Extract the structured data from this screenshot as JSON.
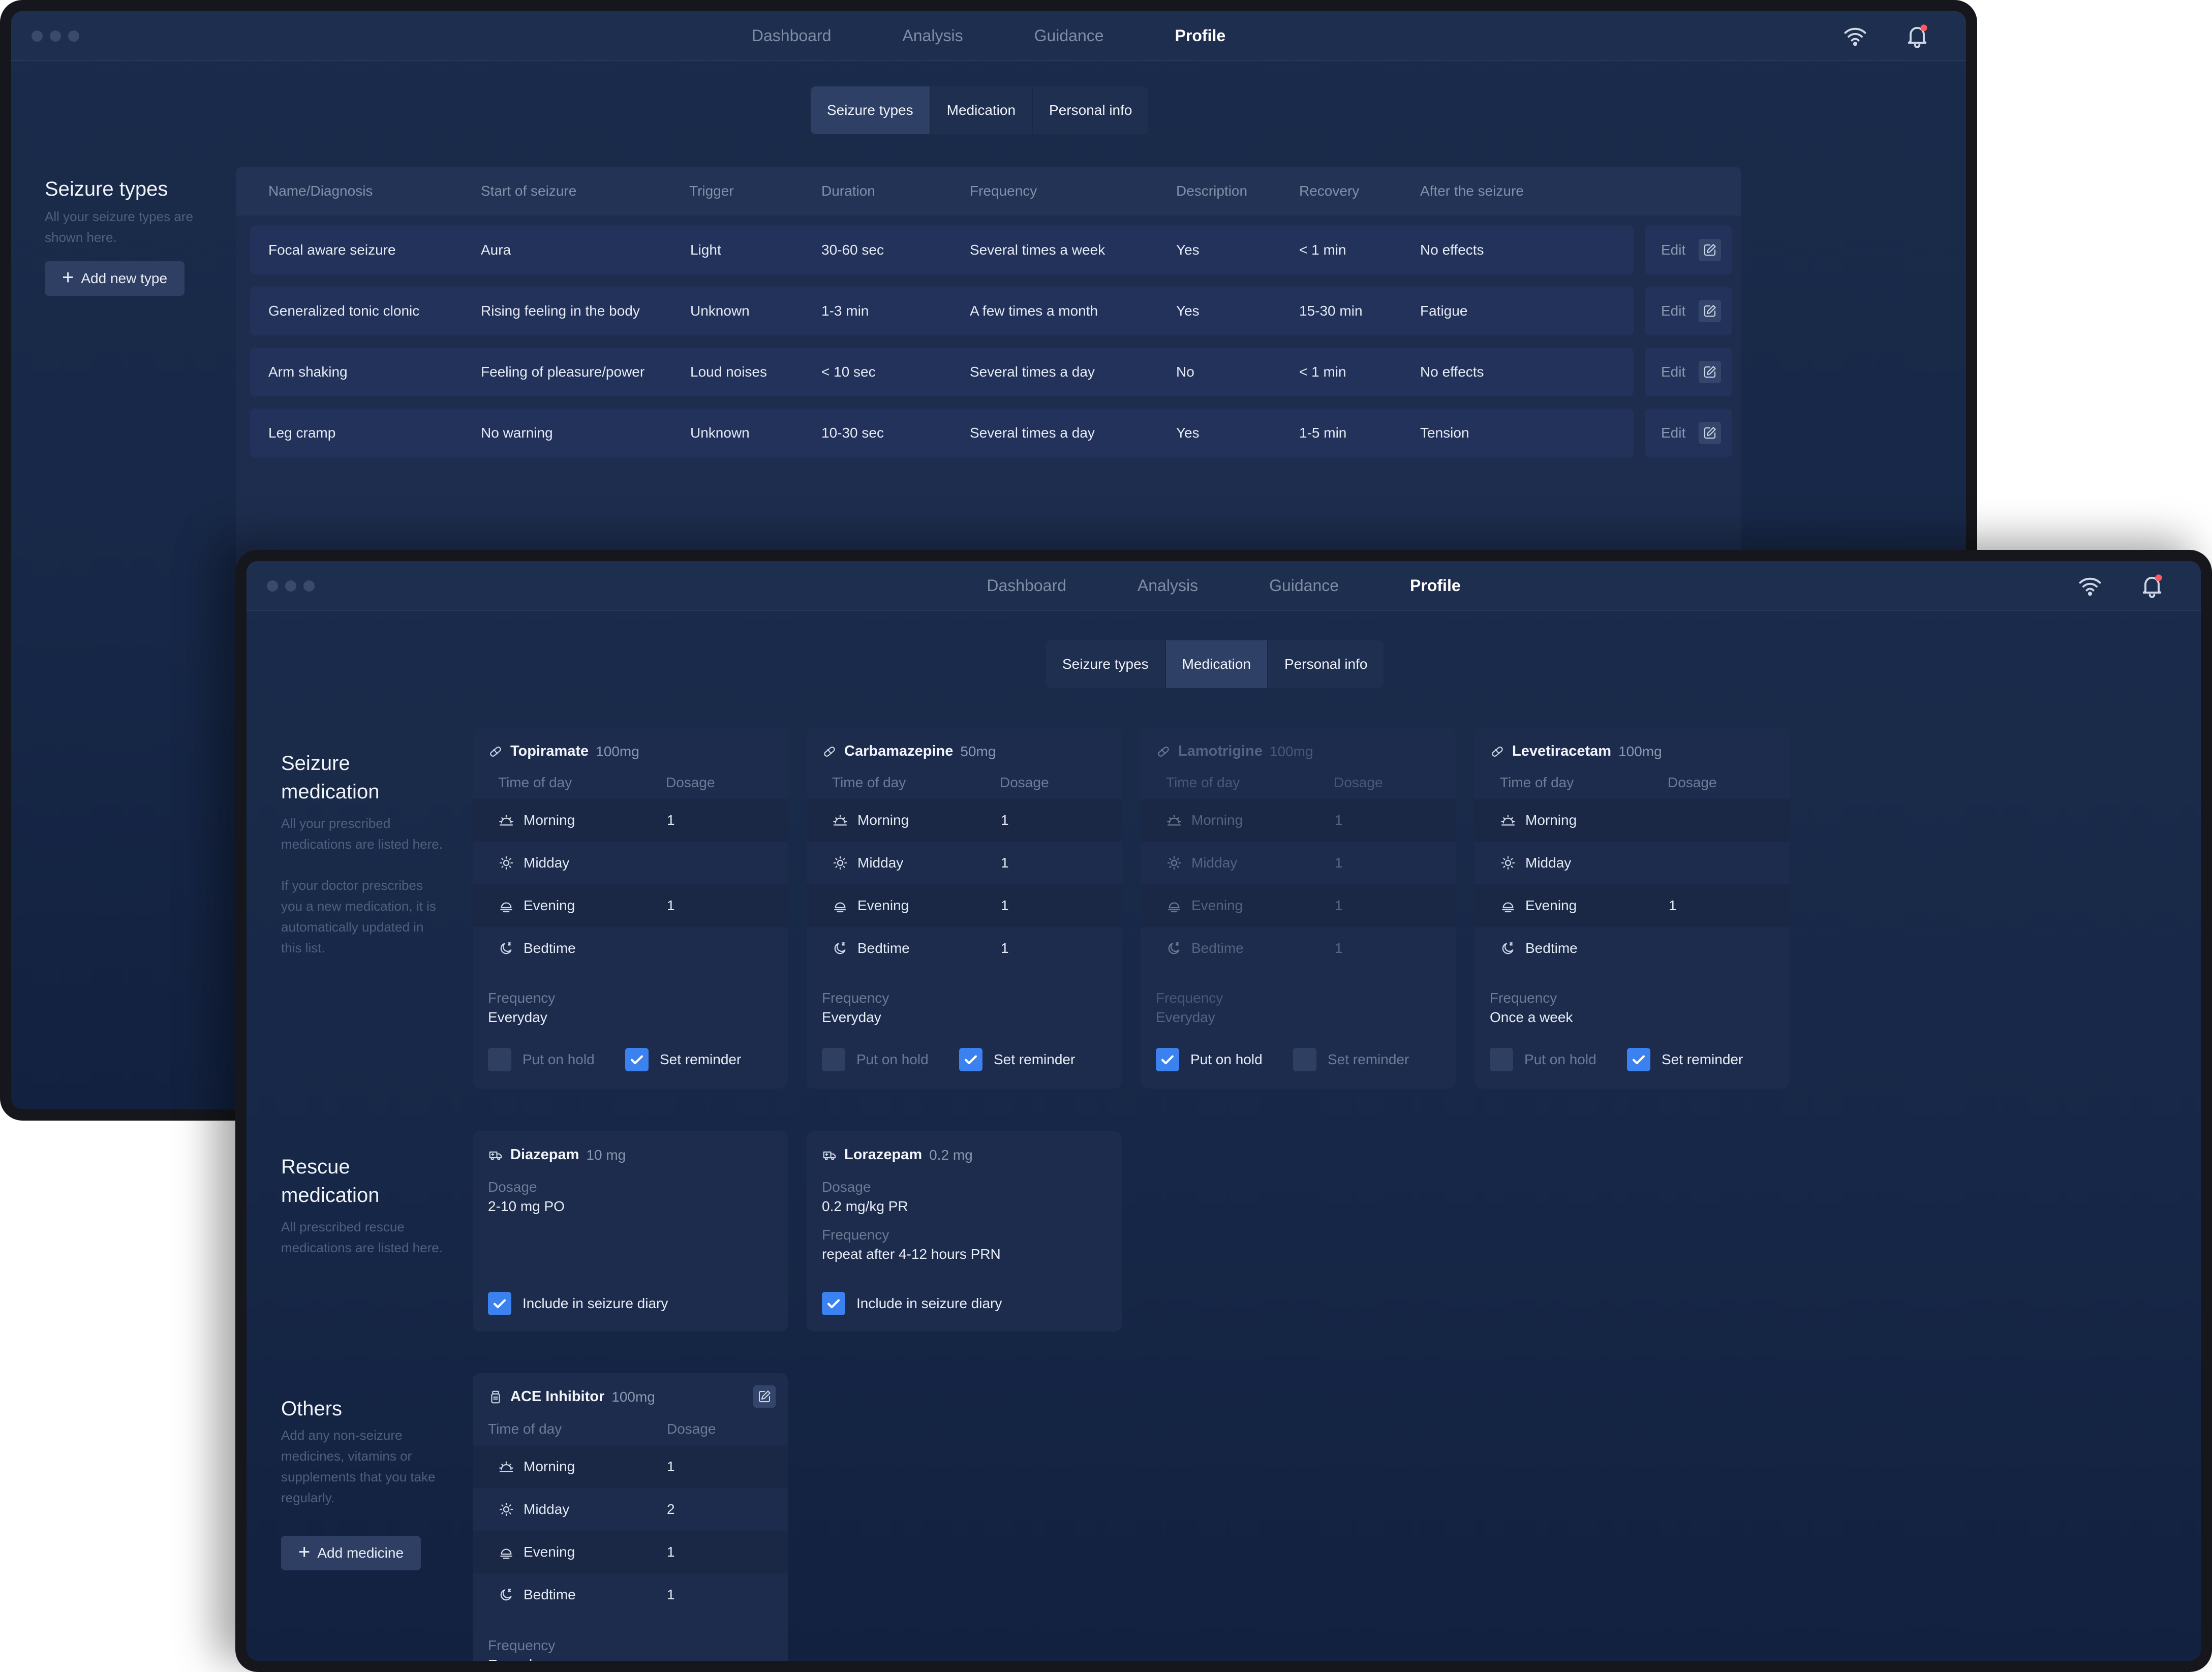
{
  "nav": {
    "items": [
      "Dashboard",
      "Analysis",
      "Guidance",
      "Profile"
    ],
    "active": "Profile"
  },
  "tabs": [
    "Seizure types",
    "Medication",
    "Personal info"
  ],
  "back": {
    "side": {
      "title": "Seizure types",
      "desc": "All your seizure types are shown here.",
      "button": "Add new type"
    },
    "table": {
      "headers": [
        "Name/Diagnosis",
        "Start of seizure",
        "Trigger",
        "Duration",
        "Frequency",
        "Description",
        "Recovery",
        "After the seizure"
      ],
      "rows": [
        [
          "Focal aware seizure",
          "Aura",
          "Light",
          "30-60 sec",
          "Several times a week",
          "Yes",
          "< 1 min",
          "No effects"
        ],
        [
          "Generalized tonic clonic",
          "Rising feeling in the body",
          "Unknown",
          "1-3 min",
          "A few times a month",
          "Yes",
          "15-30 min",
          "Fatigue"
        ],
        [
          "Arm shaking",
          "Feeling of pleasure/power",
          "Loud noises",
          "< 10 sec",
          "Several times a day",
          "No",
          "< 1 min",
          "No effects"
        ],
        [
          "Leg cramp",
          "No warning",
          "Unknown",
          "10-30 sec",
          "Several times a day",
          "Yes",
          "1-5 min",
          "Tension"
        ]
      ],
      "edit_label": "Edit"
    }
  },
  "front": {
    "sections": {
      "seizure": {
        "title": "Seizure medication",
        "desc1": "All your prescribed medications are listed here.",
        "desc2": "If your doctor prescribes you a new medication, it is automatically updated in this list."
      },
      "rescue": {
        "title": "Rescue medication",
        "desc": "All prescribed rescue medications are listed here."
      },
      "others": {
        "title": "Others",
        "desc": "Add any non-seizure medicines, vitamins or supplements that you take regularly.",
        "button": "Add medicine"
      }
    },
    "labels": {
      "time_of_day": "Time of day",
      "dosage": "Dosage",
      "frequency": "Frequency",
      "put_on_hold": "Put on hold",
      "set_reminder": "Set reminder",
      "include_diary": "Include in seizure diary",
      "times": [
        "Morning",
        "Midday",
        "Evening",
        "Bedtime"
      ]
    },
    "seizure_meds": [
      {
        "name": "Topiramate",
        "dose": "100mg",
        "dosages": [
          "1",
          "",
          "1",
          ""
        ],
        "frequency": "Everyday",
        "on_hold": false,
        "reminder": true
      },
      {
        "name": "Carbamazepine",
        "dose": "50mg",
        "dosages": [
          "1",
          "1",
          "1",
          "1"
        ],
        "frequency": "Everyday",
        "on_hold": false,
        "reminder": true
      },
      {
        "name": "Lamotrigine",
        "dose": "100mg",
        "dosages": [
          "1",
          "1",
          "1",
          "1"
        ],
        "frequency": "Everyday",
        "on_hold": true,
        "reminder": false
      },
      {
        "name": "Levetiracetam",
        "dose": "100mg",
        "dosages": [
          "",
          "",
          "1",
          ""
        ],
        "frequency": "Once a week",
        "on_hold": false,
        "reminder": true
      }
    ],
    "rescue_meds": [
      {
        "name": "Diazepam",
        "dose": "10 mg",
        "dosage": "2-10 mg PO",
        "frequency": "",
        "include": true
      },
      {
        "name": "Lorazepam",
        "dose": "0.2 mg",
        "dosage": "0.2 mg/kg PR",
        "frequency": "repeat after 4-12 hours PRN",
        "include": true
      }
    ],
    "others": [
      {
        "name": "ACE Inhibitor",
        "dose": "100mg",
        "dosages": [
          "1",
          "2",
          "1",
          "1"
        ],
        "frequency": "Everyday"
      }
    ]
  }
}
